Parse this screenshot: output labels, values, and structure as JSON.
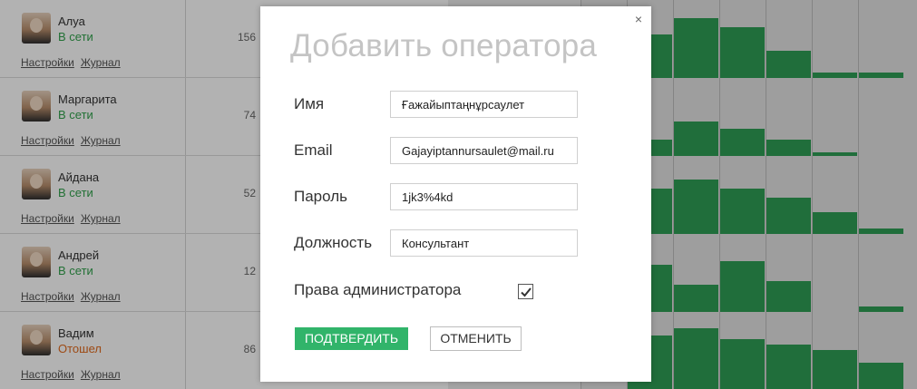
{
  "operators": [
    {
      "name": "Алуа",
      "status": "В сети",
      "count": "156",
      "settings": "Настройки",
      "journal": "Журнал"
    },
    {
      "name": "Маргарита",
      "status": "В сети",
      "count": "74",
      "settings": "Настройки",
      "journal": "Журнал"
    },
    {
      "name": "Айдана",
      "status": "В сети",
      "count": "52",
      "settings": "Настройки",
      "journal": "Журнал"
    },
    {
      "name": "Андрей",
      "status": "В сети",
      "count": "12",
      "settings": "Настройки",
      "journal": "Журнал"
    },
    {
      "name": "Вадим",
      "status": "Отошел",
      "count": "86",
      "settings": "Настройки",
      "journal": "Журнал"
    }
  ],
  "colors": {
    "online": "#31a24c",
    "away": "#e16a1e",
    "accent": "#31b46a",
    "bar": "#2e9e55"
  },
  "modal": {
    "title": "Добавить оператора",
    "close_icon": "×",
    "name_label": "Имя",
    "name_value": "Ғажайыптаңнұрсаулет",
    "email_label": "Email",
    "email_value": "Gajayiptannursaulet@mail.ru",
    "password_label": "Пароль",
    "password_value": "1jk3%4kd",
    "position_label": "Должность",
    "position_value": "Консультант",
    "admin_label": "Права администратора",
    "admin_checked": true,
    "confirm_label": "ПОДТВЕРДИТЬ",
    "cancel_label": "ОТМЕНИТЬ"
  }
}
